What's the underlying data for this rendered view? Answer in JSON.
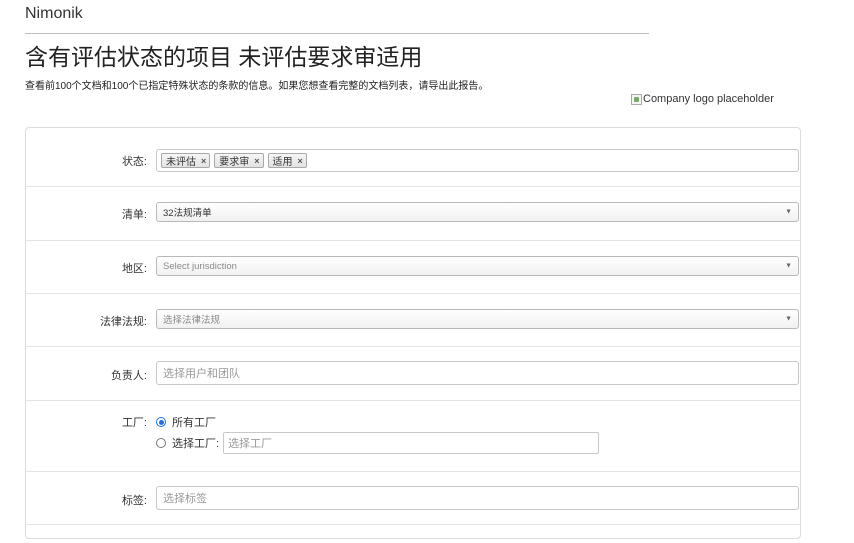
{
  "header": {
    "app_name": "Nimonik",
    "title": "含有评估状态的项目 未评估要求审适用",
    "description": "查看前100个文档和100个已指定特殊状态的条款的信息。如果您想查看完整的文档列表，请导出此报告。",
    "logo_alt": "Company logo placeholder"
  },
  "form": {
    "status": {
      "label": "状态:",
      "tags": [
        {
          "text": "未评估",
          "remove": "×"
        },
        {
          "text": "要求审",
          "remove": "×"
        },
        {
          "text": "适用",
          "remove": "×"
        }
      ]
    },
    "list": {
      "label": "清单:",
      "value": "32法规清单",
      "arrow": "▼"
    },
    "region": {
      "label": "地区:",
      "placeholder": "Select jurisdiction",
      "arrow": "▼"
    },
    "regulation": {
      "label": "法律法规:",
      "placeholder": "选择法律法规",
      "arrow": "▼"
    },
    "owner": {
      "label": "负责人:",
      "placeholder": "选择用户和团队"
    },
    "factory": {
      "label": "工厂:",
      "option_all": "所有工厂",
      "option_select": "选择工厂:",
      "placeholder": "选择工厂",
      "selected": "all"
    },
    "tags": {
      "label": "标签:",
      "placeholder": "选择标签"
    }
  },
  "colors": {
    "accent": "#1a73e8",
    "border": "#dcdcdc"
  }
}
